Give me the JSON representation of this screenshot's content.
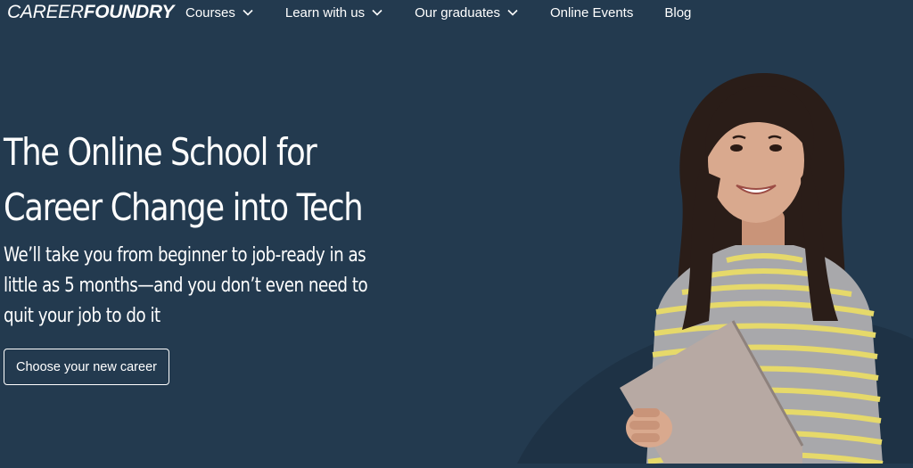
{
  "header": {
    "logo": {
      "part1": "CAREER",
      "part2": "FOUNDRY"
    },
    "nav": [
      {
        "label": "Courses",
        "has_dropdown": true,
        "icon": "chevron-down-icon"
      },
      {
        "label": "Learn with us",
        "has_dropdown": true,
        "icon": "chevron-down-icon"
      },
      {
        "label": "Our graduates",
        "has_dropdown": true,
        "icon": "chevron-down-icon"
      },
      {
        "label": "Online Events",
        "has_dropdown": false
      },
      {
        "label": "Blog",
        "has_dropdown": false
      }
    ]
  },
  "hero": {
    "title_line1": "The Online School for",
    "title_line2": "Career Change into Tech",
    "subtitle_line1": "We’ll take you from beginner to job-ready in as",
    "subtitle_line2": "little as 5 months—and you don’t even need to",
    "subtitle_line3": "quit your job to do it",
    "cta_label": "Choose your new career"
  },
  "colors": {
    "background": "#233a4f",
    "background_shape": "#1e3245",
    "text": "#ffffff",
    "sweater_stripe_yellow": "#e6d96a",
    "sweater_base": "#a8a8ab",
    "laptop": "#b7a9a3",
    "hair": "#2a1d18",
    "skin": "#d9a98e"
  }
}
